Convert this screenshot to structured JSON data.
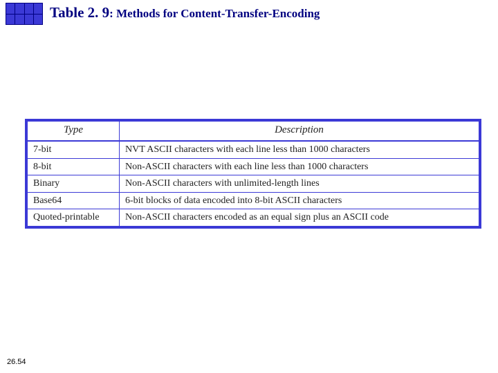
{
  "title": {
    "table_no": "Table 2. 9",
    "caption": ": Methods for Content-Transfer-Encoding"
  },
  "chart_data": {
    "type": "table",
    "title": "Methods for Content-Transfer-Encoding",
    "columns": [
      "Type",
      "Description"
    ],
    "rows": [
      [
        "7-bit",
        "NVT ASCII characters with each line less than 1000 characters"
      ],
      [
        "8-bit",
        "Non-ASCII characters with each line less than 1000 characters"
      ],
      [
        "Binary",
        "Non-ASCII characters with unlimited-length lines"
      ],
      [
        "Base64",
        "6-bit blocks of data encoded into 8-bit ASCII characters"
      ],
      [
        "Quoted-printable",
        "Non-ASCII characters encoded as an equal sign plus an ASCII code"
      ]
    ]
  },
  "page_number": "26.54"
}
